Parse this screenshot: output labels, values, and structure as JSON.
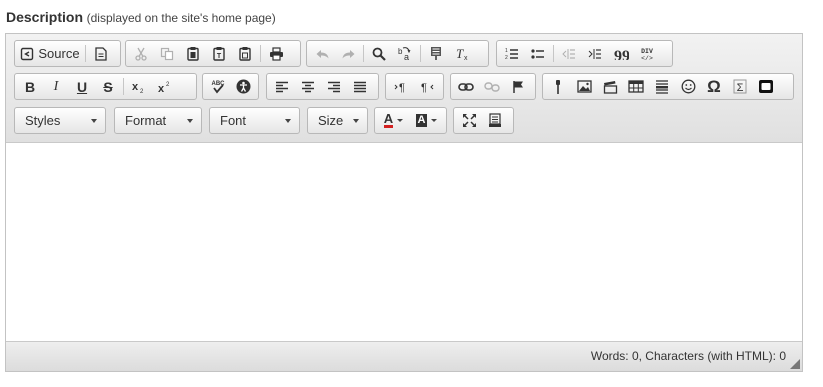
{
  "field": {
    "label": "Description",
    "hint": "(displayed on the site's home page)"
  },
  "toolbar": {
    "row1": {
      "source_label": "Source",
      "buttons": [
        "source",
        "templates",
        "cut",
        "copy",
        "paste",
        "paste-text",
        "paste-word",
        "print",
        "undo",
        "redo",
        "find",
        "replace",
        "select-all",
        "remove-format",
        "numbered-list",
        "bulleted-list",
        "outdent",
        "indent",
        "blockquote",
        "create-div"
      ]
    },
    "row2": {
      "buttons": [
        "bold",
        "italic",
        "underline",
        "strikethrough",
        "subscript",
        "superscript",
        "spellcheck",
        "accessibility",
        "align-left",
        "align-center",
        "align-right",
        "justify",
        "ltr",
        "rtl",
        "link",
        "unlink",
        "anchor",
        "flash",
        "image",
        "media",
        "table",
        "horizontal-rule",
        "smiley",
        "special-char",
        "math",
        "iframe"
      ],
      "bold_label": "B",
      "italic_label": "I",
      "underline_label": "U",
      "strike_label": "S",
      "omega_label": "Ω",
      "sigma_label": "Σ"
    },
    "row3": {
      "styles_label": "Styles",
      "format_label": "Format",
      "font_label": "Font",
      "size_label": "Size",
      "text_color_label": "A",
      "bg_color_label": "A"
    }
  },
  "content": {
    "text": ""
  },
  "status": {
    "counter": "Words: 0, Characters (with HTML): 0"
  },
  "colors": {
    "toolbar_bg": "#e6e6e6",
    "border": "#c3c3c3",
    "text_color_underline": "#d22020"
  }
}
